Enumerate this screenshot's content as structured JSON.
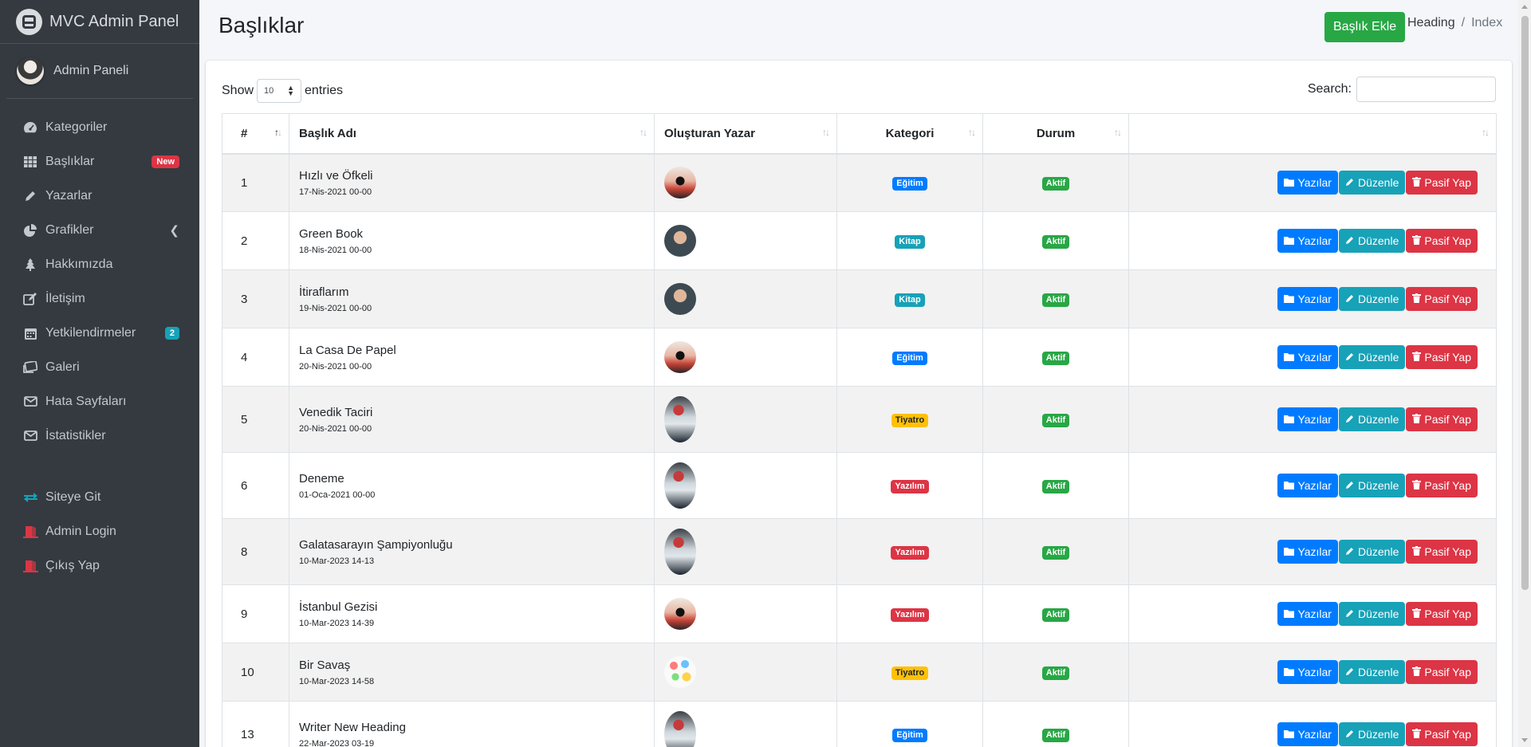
{
  "brand": {
    "name": "MVC Admin Panel"
  },
  "user": {
    "name": "Admin Paneli"
  },
  "sidebar": {
    "items": [
      {
        "label": "Kategoriler",
        "icon": "dashboard-icon"
      },
      {
        "label": "Başlıklar",
        "icon": "grid-icon",
        "badge": "New"
      },
      {
        "label": "Yazarlar",
        "icon": "pencil-icon"
      },
      {
        "label": "Grafikler",
        "icon": "pie-chart-icon"
      },
      {
        "label": "Hakkımızda",
        "icon": "tree-icon"
      },
      {
        "label": "İletişim",
        "icon": "edit-icon"
      },
      {
        "label": "Yetkilendirmeler",
        "icon": "calendar-icon",
        "badge": "2"
      },
      {
        "label": "Galeri",
        "icon": "images-icon"
      },
      {
        "label": "Hata Sayfaları",
        "icon": "envelope-icon"
      },
      {
        "label": "İstatistikler",
        "icon": "envelope-icon"
      }
    ],
    "bottom_items": [
      {
        "label": "Siteye Git",
        "icon": "exchange-icon"
      },
      {
        "label": "Admin Login",
        "icon": "door-icon"
      },
      {
        "label": "Çıkış Yap",
        "icon": "door-icon"
      }
    ]
  },
  "header": {
    "title": "Başlıklar",
    "add_button": "Başlık Ekle",
    "breadcrumb": {
      "link": "Heading",
      "separator": "/",
      "active": "Index"
    }
  },
  "table_controls": {
    "show": "Show",
    "entries_value": "10",
    "entries": "entries",
    "search_label": "Search:"
  },
  "table": {
    "columns": [
      "#",
      "Başlık Adı",
      "Oluşturan Yazar",
      "Kategori",
      "Durum",
      ""
    ],
    "action_labels": {
      "posts": "Yazılar",
      "edit": "Düzenle",
      "deactivate": "Pasif Yap"
    },
    "rows": [
      {
        "id": "1",
        "title": "Hızlı ve Öfkeli",
        "date": "17-Nis-2021 00-00",
        "avatar": "silhouette",
        "category": "Eğitim",
        "cat_color": "blue",
        "status": "Aktif"
      },
      {
        "id": "2",
        "title": "Green Book",
        "date": "18-Nis-2021 00-00",
        "avatar": "man",
        "category": "Kitap",
        "cat_color": "teal",
        "status": "Aktif"
      },
      {
        "id": "3",
        "title": "İtiraflarım",
        "date": "19-Nis-2021 00-00",
        "avatar": "man",
        "category": "Kitap",
        "cat_color": "teal",
        "status": "Aktif"
      },
      {
        "id": "4",
        "title": "La Casa De Papel",
        "date": "20-Nis-2021 00-00",
        "avatar": "silhouette",
        "category": "Eğitim",
        "cat_color": "blue",
        "status": "Aktif"
      },
      {
        "id": "5",
        "title": "Venedik Taciri",
        "date": "20-Nis-2021 00-00",
        "avatar": "girl",
        "category": "Tiyatro",
        "cat_color": "yellow",
        "status": "Aktif"
      },
      {
        "id": "6",
        "title": "Deneme",
        "date": "01-Oca-2021 00-00",
        "avatar": "girl",
        "category": "Yazılım",
        "cat_color": "red",
        "status": "Aktif"
      },
      {
        "id": "8",
        "title": "Galatasarayın Şampiyonluğu",
        "date": "10-Mar-2023 14-13",
        "avatar": "girl",
        "category": "Yazılım",
        "cat_color": "red",
        "status": "Aktif"
      },
      {
        "id": "9",
        "title": "İstanbul Gezisi",
        "date": "10-Mar-2023 14-39",
        "avatar": "silhouette",
        "category": "Yazılım",
        "cat_color": "red",
        "status": "Aktif"
      },
      {
        "id": "10",
        "title": "Bir Savaş",
        "date": "10-Mar-2023 14-58",
        "avatar": "colorful",
        "category": "Tiyatro",
        "cat_color": "yellow",
        "status": "Aktif"
      },
      {
        "id": "13",
        "title": "Writer New Heading",
        "date": "22-Mar-2023 03-19",
        "avatar": "girl",
        "category": "Eğitim",
        "cat_color": "blue",
        "status": "Aktif"
      }
    ]
  }
}
